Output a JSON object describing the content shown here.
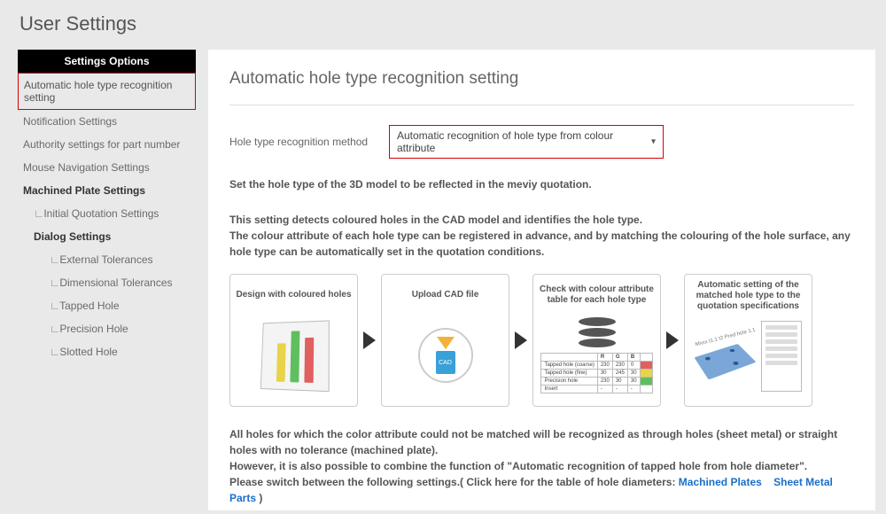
{
  "page_title": "User Settings",
  "sidebar": {
    "header": "Settings Options",
    "items": [
      {
        "label": "Automatic hole type recognition setting",
        "active": true
      },
      {
        "label": "Notification Settings"
      },
      {
        "label": "Authority settings for part number"
      },
      {
        "label": "Mouse Navigation Settings"
      },
      {
        "label": "Machined Plate Settings",
        "bold": true
      },
      {
        "label": "Initial Quotation Settings",
        "level": 1
      },
      {
        "label": "Dialog Settings",
        "bold": true,
        "level": 1,
        "noPrefix": true
      },
      {
        "label": "External Tolerances",
        "level": 2
      },
      {
        "label": "Dimensional Tolerances",
        "level": 2
      },
      {
        "label": "Tapped Hole",
        "level": 2
      },
      {
        "label": "Precision Hole",
        "level": 2
      },
      {
        "label": "Slotted Hole",
        "level": 2
      }
    ]
  },
  "main": {
    "title": "Automatic hole type recognition setting",
    "method_label": "Hole type recognition method",
    "method_value": "Automatic recognition of hole type from colour attribute",
    "intro": "Set the hole type of the 3D model to be reflected in the meviy quotation.",
    "explain1": "This setting detects coloured holes in the CAD model and identifies the hole type.",
    "explain2": "The colour attribute of each hole type can be registered in advance, and by matching the colouring of the hole surface, any hole type can be automatically set in the quotation conditions.",
    "steps": [
      "Design with coloured holes",
      "Upload CAD file",
      "Check with colour attribute table for each hole type",
      "Automatic setting of the matched hole type to the quotation specifications"
    ],
    "step2_tag": "CAD",
    "step3_table": {
      "headers": [
        "",
        "R",
        "G",
        "B",
        ""
      ],
      "rows": [
        [
          "Tapped hole (coarse)",
          "230",
          "230",
          "0",
          "r"
        ],
        [
          "Tapped hole (fine)",
          "30",
          "245",
          "30",
          "y"
        ],
        [
          "Precision hole",
          "230",
          "30",
          "30",
          "g"
        ],
        [
          "Insert",
          "-",
          "-",
          "-",
          ""
        ]
      ]
    },
    "step4_labels": "Mxxx t1.1 t2\nPred hole 1.1",
    "bottom1": "All holes for which the color attribute could not be matched will be recognized as through holes (sheet metal) or straight holes with no tolerance (machined plate).",
    "bottom2": "However, it is also possible to combine the function of \"Automatic recognition of tapped hole from hole diameter\".",
    "bottom3_pre": "Please switch between the following settings.( Click here for the table of hole diameters: ",
    "link1": "Machined Plates",
    "link2": "Sheet Metal Parts",
    "bottom3_post": " )"
  }
}
